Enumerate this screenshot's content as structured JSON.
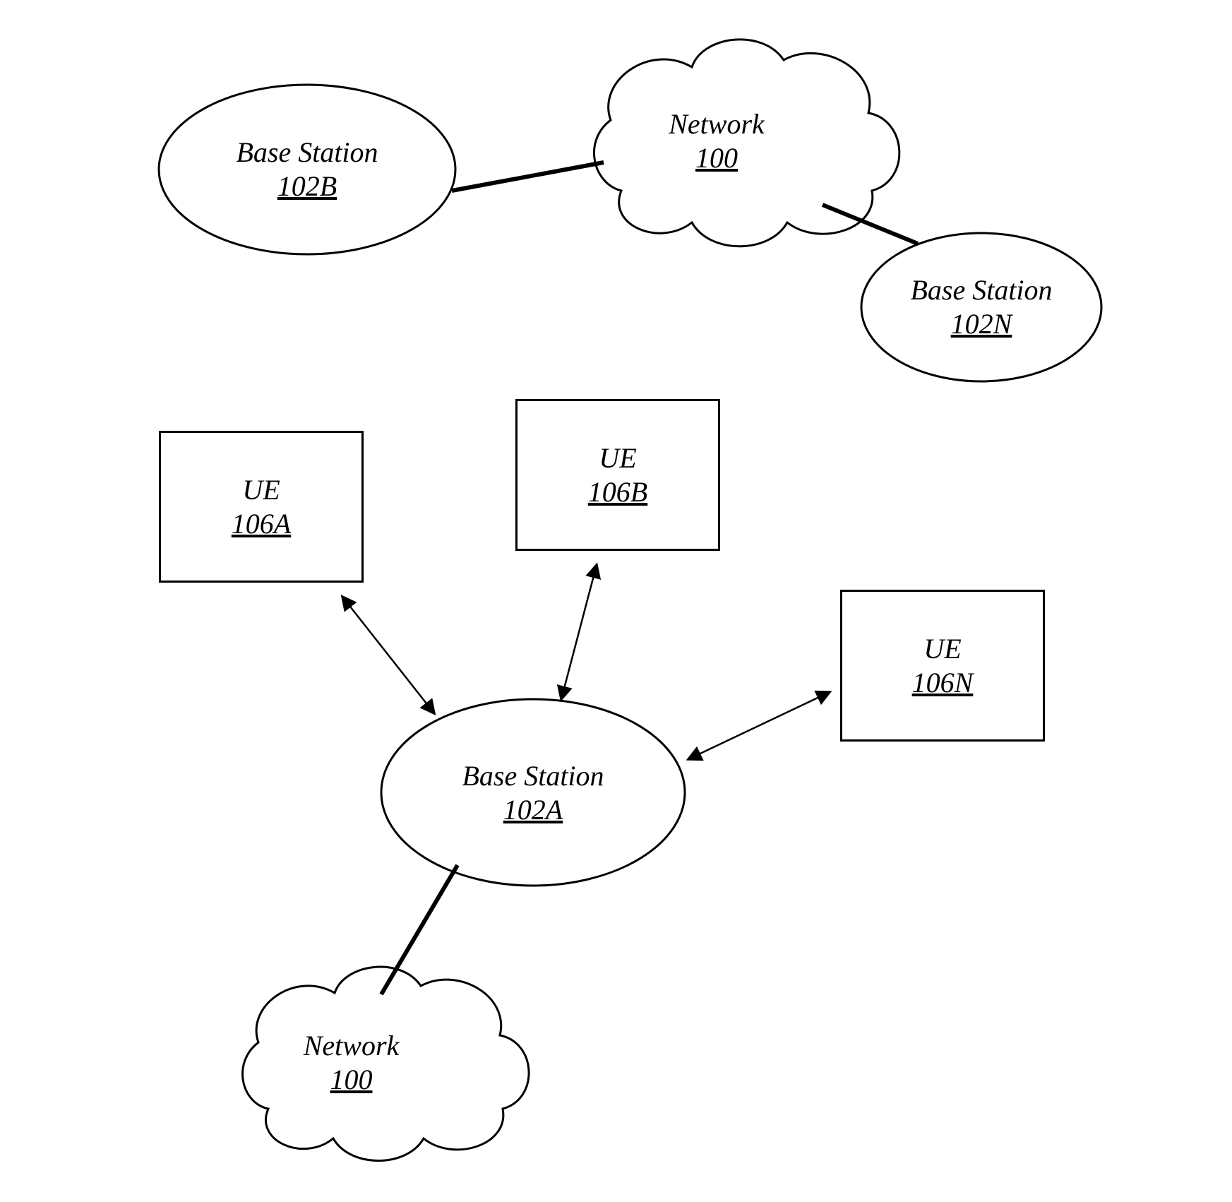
{
  "nodes": {
    "bs102b": {
      "title": "Base Station",
      "ref": "102B"
    },
    "net100_top": {
      "title": "Network",
      "ref": "100"
    },
    "bs102n": {
      "title": "Base Station",
      "ref": "102N"
    },
    "ue106a": {
      "title": "UE",
      "ref": "106A"
    },
    "ue106b": {
      "title": "UE",
      "ref": "106B"
    },
    "ue106n": {
      "title": "UE",
      "ref": "106N"
    },
    "bs102a": {
      "title": "Base Station",
      "ref": "102A"
    },
    "net100_bot": {
      "title": "Network",
      "ref": "100"
    }
  },
  "edges": [
    {
      "from": "bs102b",
      "to": "net100_top",
      "bidir": false
    },
    {
      "from": "net100_top",
      "to": "bs102n",
      "bidir": false
    },
    {
      "from": "ue106a",
      "to": "bs102a",
      "bidir": true
    },
    {
      "from": "ue106b",
      "to": "bs102a",
      "bidir": true
    },
    {
      "from": "ue106n",
      "to": "bs102a",
      "bidir": true
    },
    {
      "from": "bs102a",
      "to": "net100_bot",
      "bidir": false
    }
  ]
}
